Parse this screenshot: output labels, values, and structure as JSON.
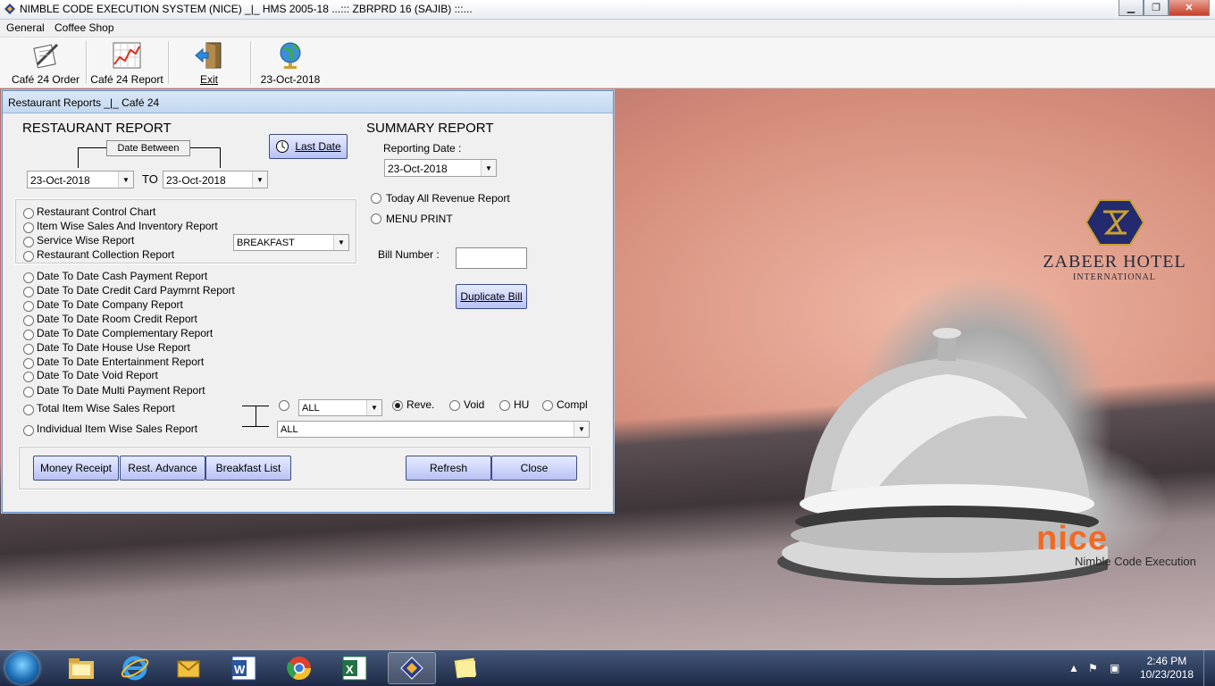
{
  "window": {
    "title": "NIMBLE CODE EXECUTION SYSTEM (NICE) _|_ HMS 2005-18 ...::: ZBRPRD 16 (SAJIB) :::..."
  },
  "menu": [
    "General",
    "Coffee Shop"
  ],
  "toolbar": {
    "cafe_order": "Café 24 Order",
    "cafe_report": "Café 24 Report",
    "exit": "Exit",
    "date": "23-Oct-2018"
  },
  "dialog": {
    "title": "Restaurant Reports _|_ Café 24",
    "restaurant_report": "RESTAURANT REPORT",
    "date_between": "Date Between",
    "last_date": "Last Date",
    "from_date": "23-Oct-2018",
    "to_label": "TO",
    "to_date": "23-Oct-2018",
    "summary_report": "SUMMARY REPORT",
    "reporting_date_label": "Reporting Date :",
    "reporting_date": "23-Oct-2018",
    "today_revenue": "Today All Revenue Report",
    "menu_print": "MENU PRINT",
    "bill_number_label": "Bill Number :",
    "bill_number_value": "",
    "duplicate_bill": "Duplicate Bill",
    "meal_select": "BREAKFAST",
    "reports_group1": [
      "Restaurant Control Chart",
      "Item Wise Sales And Inventory Report",
      "Service Wise Report",
      "Restaurant Collection Report"
    ],
    "reports_group2": [
      "Date To Date Cash Payment Report",
      "Date To Date Credit Card Paymrnt Report",
      "Date To Date Company Report",
      "Date To Date Room Credit Report",
      "Date To Date Complementary Report",
      "Date To Date House Use Report",
      "Date To Date Entertainment Report",
      "Date To Date Void Report",
      "Date To Date Multi Payment Report"
    ],
    "total_item_wise": "Total Item Wise Sales Report",
    "individual_item_wise": "Individual Item Wise Sales Report",
    "filter_select": "ALL",
    "item_select": "ALL",
    "types": [
      "Reve.",
      "Void",
      "HU",
      "Compl"
    ],
    "selected_type": "Reve.",
    "buttons": {
      "money_receipt": "Money Receipt",
      "rest_advance": "Rest. Advance",
      "breakfast_list": "Breakfast List",
      "refresh": "Refresh",
      "close": "Close"
    }
  },
  "brand": {
    "name": "ZABEER HOTEL",
    "sub": "INTERNATIONAL"
  },
  "logo": {
    "name": "nice",
    "tagline": "Nimble Code Execution"
  },
  "taskbar": {
    "time": "2:46 PM",
    "date": "10/23/2018"
  },
  "colors": {
    "accent_orange": "#f06a24",
    "button_blue": "#b8c2f4"
  }
}
